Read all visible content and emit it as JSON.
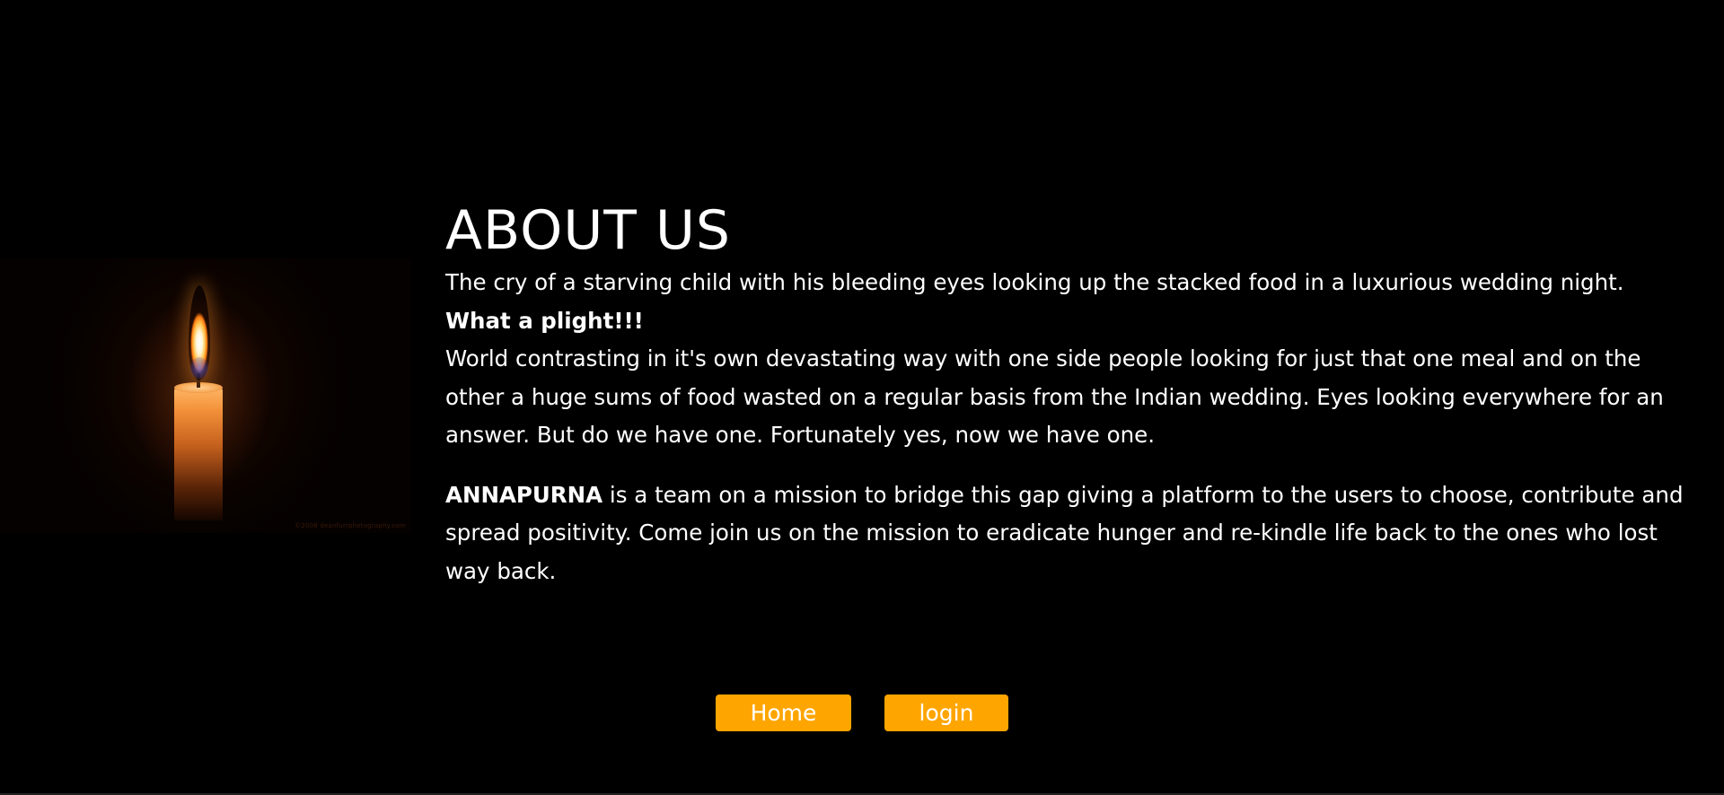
{
  "about": {
    "title": "ABOUT US",
    "intro_line": "The cry of a starving child with his bleeding eyes looking up the stacked food in a luxurious wedding night.",
    "plight": "What a plight!!!",
    "contrast_text": "World contrasting in it's own devastating way with one side people looking for just that one meal and on the other a huge sums of food wasted on a regular basis from the Indian wedding. Eyes looking everywhere for an answer. But do we have one. Fortunately yes, now we have one.",
    "brand": "ANNAPURNA",
    "mission_text": " is a team on a mission to bridge this gap giving a platform to the users to choose, contribute and spread positivity. Come join us on the mission to eradicate hunger and re-kindle life back to the ones who lost way back."
  },
  "image": {
    "icon": "candle-image",
    "watermark": "©2008 deanfurrphotography.com"
  },
  "buttons": {
    "home_label": "Home",
    "login_label": "login"
  },
  "colors": {
    "background": "#000000",
    "text": "#ffffff",
    "button": "#ffa500"
  }
}
